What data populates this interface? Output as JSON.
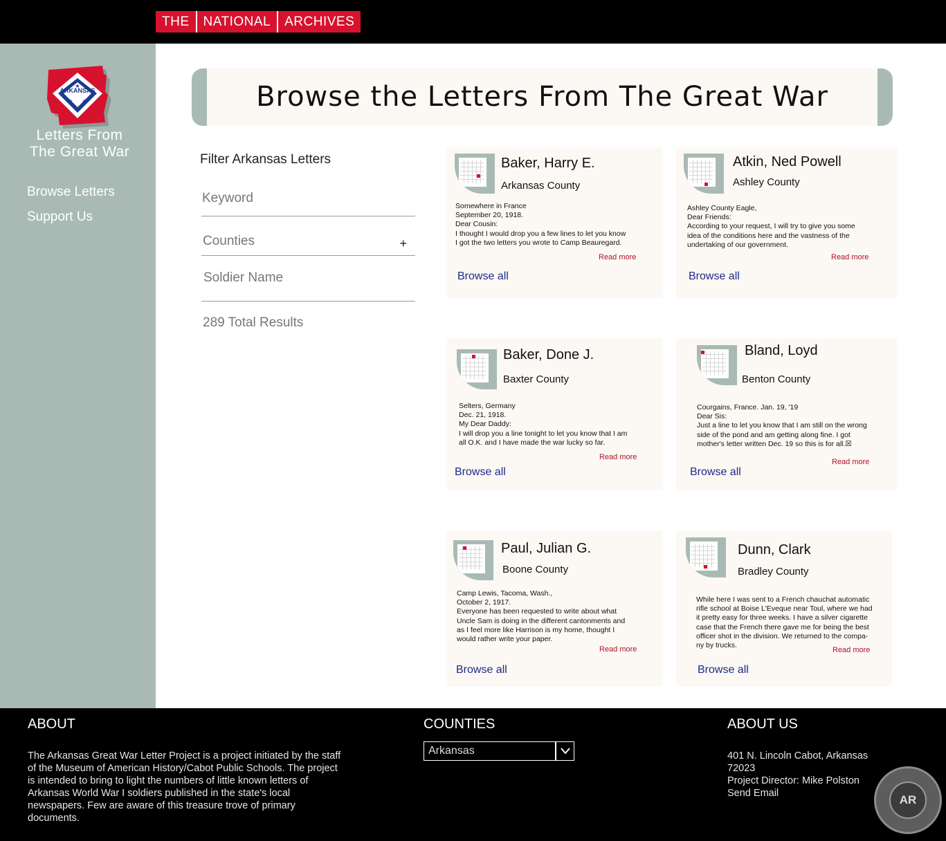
{
  "header": {
    "logo_words": [
      "THE",
      "NATIONAL",
      "ARCHIVES"
    ]
  },
  "sidebar": {
    "flag_label": "ARKANSAS",
    "site_title_line1": "Letters From",
    "site_title_line2": "The Great War",
    "nav": [
      {
        "label": "Browse Letters"
      },
      {
        "label": "Support Us"
      }
    ]
  },
  "banner": {
    "title": "Browse the Letters From The Great War"
  },
  "filter": {
    "title": "Filter Arkansas Letters",
    "keyword_placeholder": "Keyword",
    "counties_label": "Counties",
    "counties_toggle": "+",
    "soldier_placeholder": "Soldier Name",
    "results": "289 Total Results"
  },
  "cards": [
    {
      "name": "Baker, Harry E.",
      "county": "Arkansas County",
      "excerpt": [
        "Somewhere in France",
        "September 20, 1918.",
        "Dear Cousin:",
        "I thought I would drop you a few lines to let you know",
        "I got the two letters you wrote to Camp Beauregard."
      ],
      "read_more": "Read more",
      "browse_all": "Browse all"
    },
    {
      "name": "Atkin, Ned Powell",
      "county": "Ashley County",
      "excerpt": [
        "Ashley County Eagle,",
        "Dear Friends:",
        "According to your request, I will try to give you some",
        "idea of the conditions here and the vastness of the",
        "undertaking of our government."
      ],
      "read_more": "Read more",
      "browse_all": "Browse all"
    },
    {
      "name": "Baker, Done J.",
      "county": "Baxter County",
      "excerpt": [
        "Selters, Germany",
        "Dec. 21, 1918.",
        "My Dear Daddy:",
        "I will drop you a line tonight to let you know that I am",
        "all O.K. and I have made the war lucky so far."
      ],
      "read_more": "Read more",
      "browse_all": "Browse all"
    },
    {
      "name": "Bland, Loyd",
      "county": "Benton County",
      "excerpt": [
        "Courgains, France. Jan. 19, '19",
        "Dear Sis:",
        "Just a line to let you know that I am still on the wrong",
        "side of the pond and am getting along fine. I got",
        "mother's letter written Dec. 19 so this is for all.☒"
      ],
      "read_more": "Read more",
      "browse_all": "Browse all"
    },
    {
      "name": "Paul, Julian G.",
      "county": "Boone County",
      "excerpt": [
        "Camp Lewis, Tacoma, Wash.,",
        " October 2, 1917.",
        " Everyone has been requested to write about what",
        "Uncle Sam is doing in the different cantonments and",
        "as I feel more like Harrison is my home, thought I",
        "would rather write your paper."
      ],
      "read_more": "Read more",
      "browse_all": "Browse all"
    },
    {
      "name": "Dunn, Clark",
      "county": "Bradley County",
      "excerpt": [
        "While here I was sent to a French chauchat automatic",
        "rifle school at Boise L'Eveque near Toul, where we had",
        "it pretty easy for three weeks. I have a silver cigarette",
        "case that the French there gave me for being the best",
        "officer shot in the division. We returned to the compa-",
        "ny by trucks."
      ],
      "read_more": "Read more",
      "browse_all": "Browse all"
    }
  ],
  "footer": {
    "about_heading": "ABOUT",
    "about_text": "The Arkansas Great War Letter Project  is a project initiated by the staff of the Museum of American History/Cabot Public Schools. The project is intended to bring to light the numbers of little known letters of Arkansas World War I soldiers published in the state's local newspapers. Few are aware of this treasure trove of primary documents.",
    "counties_heading": "COUNTIES",
    "county_selected": "Arkansas",
    "aboutus_heading": "ABOUT US",
    "address_line1": "401 N. Lincoln Cabot, Arkansas",
    "address_line2": "72023",
    "director": "Project Director: Mike Polston",
    "send_email": "Send Email",
    "seal_text": "AR"
  },
  "colors": {
    "brand_red": "#d6122f",
    "sidebar_sage": "#a9bab5",
    "card_bg": "#fcf8f3",
    "link_blue": "#1c2a8a"
  }
}
